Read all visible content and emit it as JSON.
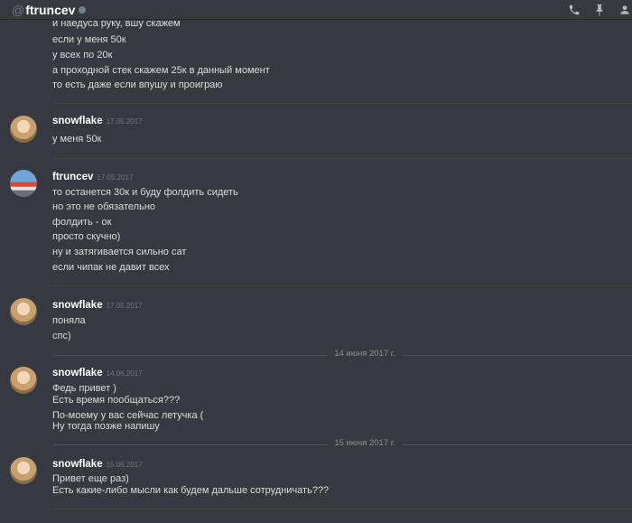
{
  "header": {
    "at_symbol": "@",
    "title": "ftruncev",
    "status": "offline",
    "icons": [
      "phone-icon",
      "pin-icon",
      "member-list-icon"
    ]
  },
  "prev_messages": [
    "и наедуса руку, вшу скажем",
    "если у меня 50к",
    "у всех по 20к",
    "а проходной стек скажем 25к в данный момент",
    "то есть даже если впушу и проиграю"
  ],
  "groups": [
    {
      "author": "snowflake",
      "timestamp": "17.05.2017",
      "lines": [
        "у меня 50к"
      ]
    },
    {
      "author": "ftruncev",
      "timestamp": "17.05.2017",
      "lines": [
        "то останется 30к и буду фолдить сидеть",
        "но это не обязательно",
        "фолдить - ок",
        "просто скучно)",
        "ну и затягивается сильно сат",
        "если чипак не давит всех"
      ]
    },
    {
      "author": "snowflake",
      "timestamp": "17.05.2017",
      "lines": [
        "поняла",
        "спс)"
      ]
    },
    {
      "author": "snowflake",
      "timestamp": "14.06.2017",
      "lines": [
        "Федь привет )",
        "Есть время пообщаться???",
        "По-моему у вас сейчас летучка  (",
        "Ну тогда позже напишу"
      ]
    },
    {
      "author": "snowflake",
      "timestamp": "15.06.2017",
      "lines": [
        "Привет еще раз)",
        "Есть какие-либо мысли как будем дальше сотрудничать???"
      ]
    }
  ],
  "dividers": [
    "14 июня 2017 г.",
    "15 июня 2017 г."
  ],
  "colors": {
    "background": "#36393f",
    "username": "#ffffff",
    "text": "#dcddde",
    "muted": "#72767d"
  }
}
